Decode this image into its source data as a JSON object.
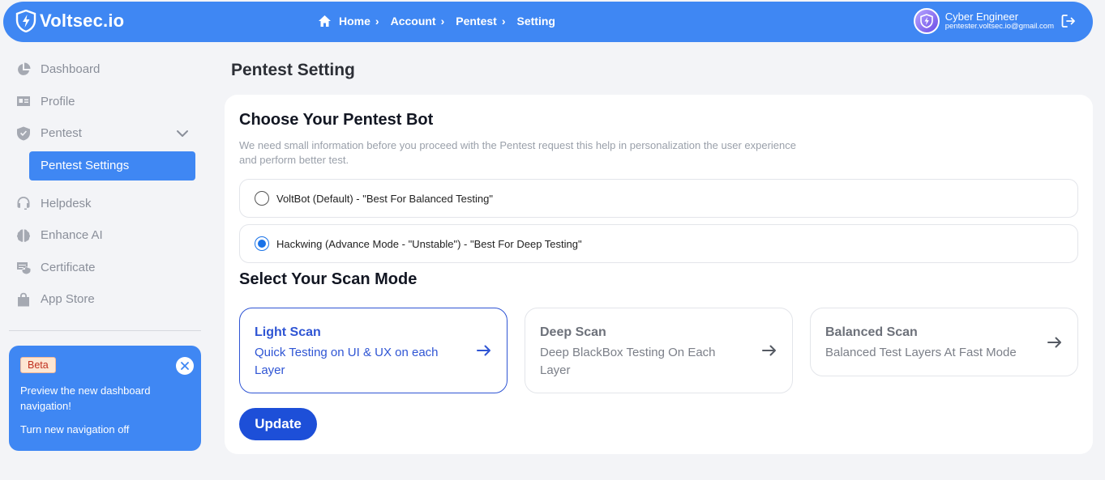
{
  "header": {
    "logo_text": "Voltsec.io",
    "breadcrumbs": [
      "Home",
      "Account",
      "Pentest",
      "Setting"
    ],
    "user_name": "Cyber Engineer",
    "user_email": "pentester.voltsec.io@gmail.com"
  },
  "sidebar": {
    "items": [
      {
        "label": "Dashboard",
        "icon": "pie-chart-icon"
      },
      {
        "label": "Profile",
        "icon": "id-card-icon"
      },
      {
        "label": "Pentest",
        "icon": "shield-check-icon"
      },
      {
        "label": "Pentest Settings"
      },
      {
        "label": "Helpdesk",
        "icon": "headset-icon"
      },
      {
        "label": "Enhance AI",
        "icon": "brain-icon"
      },
      {
        "label": "Certificate",
        "icon": "certificate-icon"
      },
      {
        "label": "App Store",
        "icon": "bag-icon"
      }
    ]
  },
  "promo": {
    "badge": "Beta",
    "text": "Preview the new dashboard navigation!",
    "link": "Turn new navigation off"
  },
  "main": {
    "page_title": "Pentest Setting",
    "bot_heading": "Choose Your Pentest Bot",
    "bot_description": "We need small information before you proceed with the Pentest request this help in personalization the user experience and perform better test.",
    "bots": [
      {
        "label": "VoltBot (Default) - \"Best For Balanced Testing\"",
        "selected": false
      },
      {
        "label": "Hackwing (Advance Mode - \"Unstable\") - \"Best For Deep Testing\"",
        "selected": true
      }
    ],
    "scan_heading": "Select Your Scan Mode",
    "scan_modes": [
      {
        "title": "Light Scan",
        "description": "Quick Testing on UI & UX on each Layer",
        "active": true
      },
      {
        "title": "Deep Scan",
        "description": "Deep BlackBox Testing On Each Layer",
        "active": false
      },
      {
        "title": "Balanced Scan",
        "description": "Balanced Test Layers At Fast Mode",
        "active": false
      }
    ],
    "update_label": "Update"
  },
  "colors": {
    "primary": "#3f87f3",
    "button": "#1d4fd8",
    "active_mode": "#2f55d4"
  }
}
